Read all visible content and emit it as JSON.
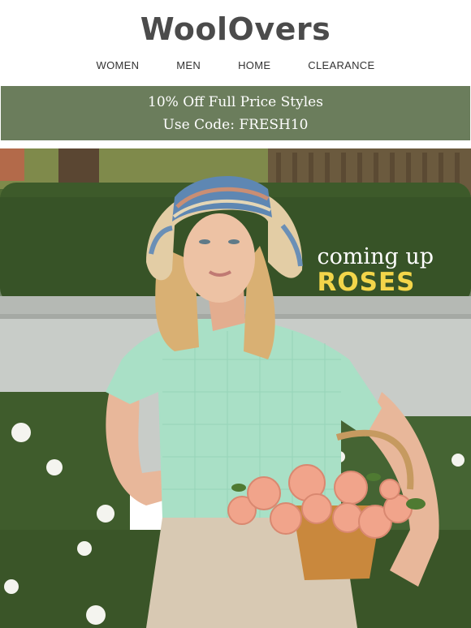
{
  "brand": {
    "logo_text": "WoolOvers"
  },
  "nav": {
    "items": [
      {
        "label": "WOMEN"
      },
      {
        "label": "MEN"
      },
      {
        "label": "HOME"
      },
      {
        "label": "CLEARANCE"
      }
    ]
  },
  "promo": {
    "line1": "10% Off Full Price Styles",
    "line2": "Use Code: FRESH10",
    "bg_color": "#6b7d5c"
  },
  "hero": {
    "headline_line1": "coming up",
    "headline_line2": "ROSES",
    "headline_accent_color": "#f3d54a"
  }
}
